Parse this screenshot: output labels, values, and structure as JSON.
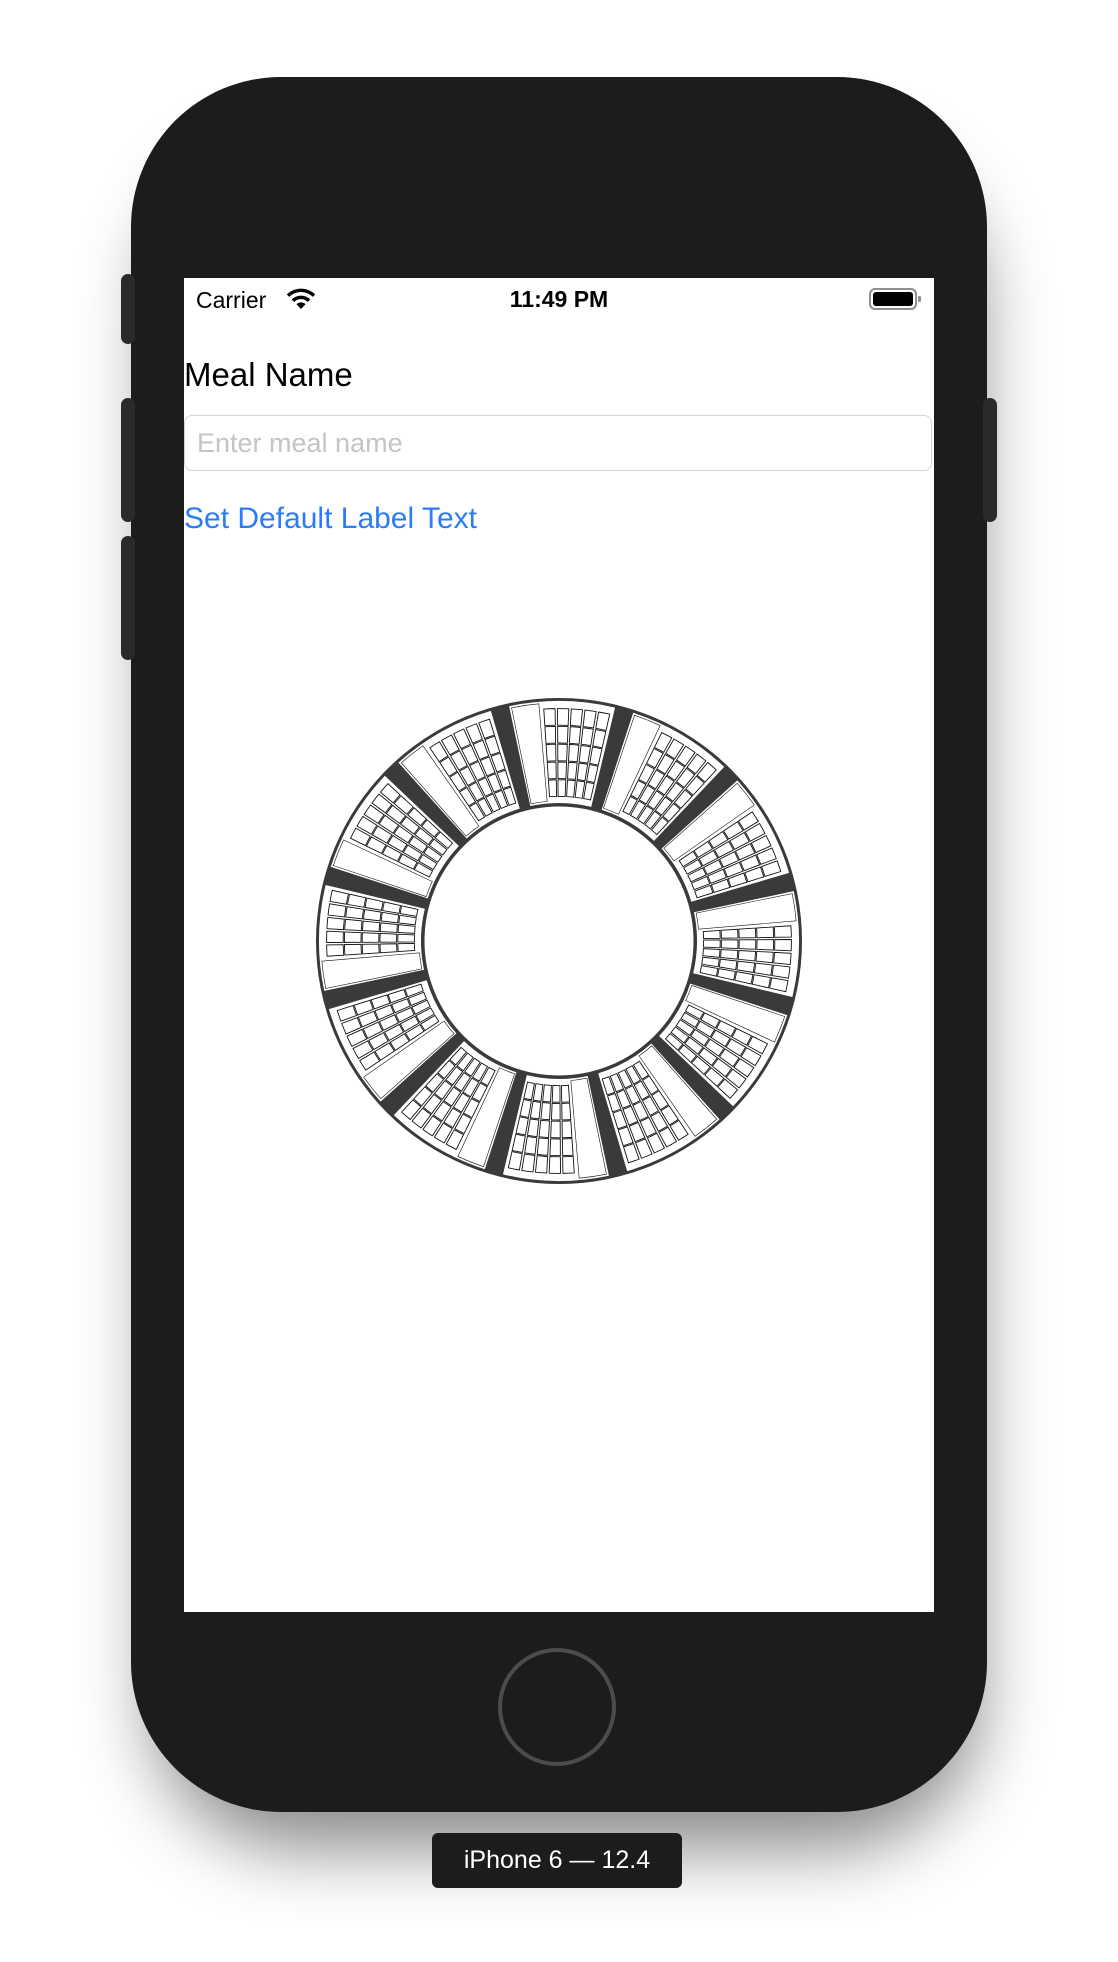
{
  "status_bar": {
    "carrier": "Carrier",
    "time": "11:49 PM",
    "wifi_icon": "wifi-icon",
    "battery_icon": "battery-full-icon"
  },
  "form": {
    "meal_label": "Meal Name",
    "meal_input_value": "",
    "meal_input_placeholder": "Enter meal name",
    "default_button_label": "Set Default Label Text"
  },
  "wheel": {
    "segment_count": 12,
    "colors": {
      "ring": "#3a3a3a",
      "cell": "#ffffff",
      "line": "#111111"
    }
  },
  "device": {
    "label": "iPhone 6 — 12.4",
    "home_button_icon": "home-button"
  },
  "colors": {
    "accent": "#2c7cf6",
    "bezel": "#1c1c1c",
    "placeholder": "#c4c4c7"
  }
}
